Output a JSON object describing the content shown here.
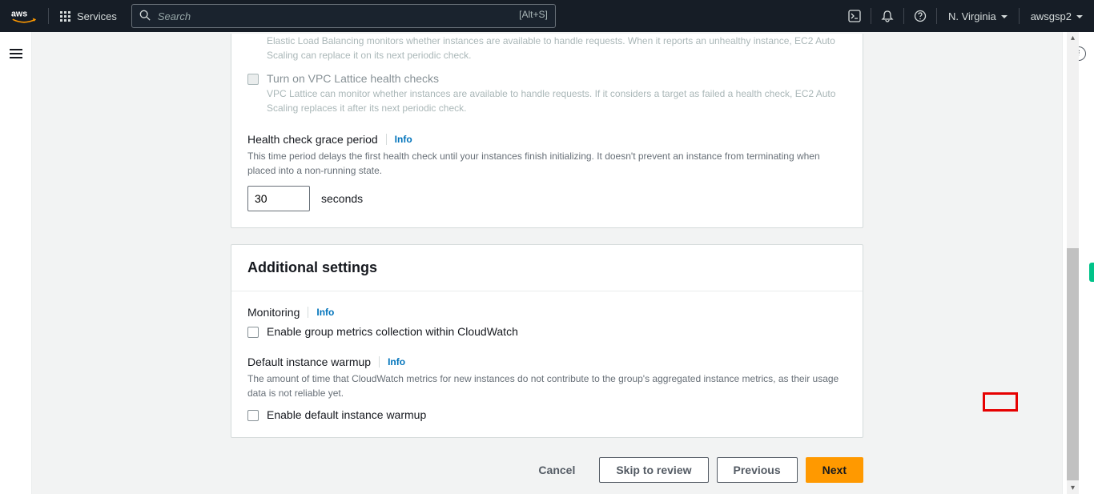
{
  "topnav": {
    "services_label": "Services",
    "search_placeholder": "Search",
    "search_shortcut": "[Alt+S]",
    "region": "N. Virginia",
    "user": "awsgsp2"
  },
  "health_checks": {
    "elb_desc": "Elastic Load Balancing monitors whether instances are available to handle requests. When it reports an unhealthy instance, EC2 Auto Scaling can replace it on its next periodic check.",
    "vpc_label": "Turn on VPC Lattice health checks",
    "vpc_desc": "VPC Lattice can monitor whether instances are available to handle requests. If it considers a target as failed a health check, EC2 Auto Scaling replaces it after its next periodic check.",
    "grace_label": "Health check grace period",
    "grace_info": "Info",
    "grace_desc": "This time period delays the first health check until your instances finish initializing. It doesn't prevent an instance from terminating when placed into a non-running state.",
    "grace_value": "30",
    "grace_unit": "seconds"
  },
  "additional": {
    "title": "Additional settings",
    "monitoring_label": "Monitoring",
    "monitoring_info": "Info",
    "monitoring_checkbox": "Enable group metrics collection within CloudWatch",
    "warmup_label": "Default instance warmup",
    "warmup_info": "Info",
    "warmup_desc": "The amount of time that CloudWatch metrics for new instances do not contribute to the group's aggregated instance metrics, as their usage data is not reliable yet.",
    "warmup_checkbox": "Enable default instance warmup"
  },
  "buttons": {
    "cancel": "Cancel",
    "skip": "Skip to review",
    "previous": "Previous",
    "next": "Next"
  }
}
